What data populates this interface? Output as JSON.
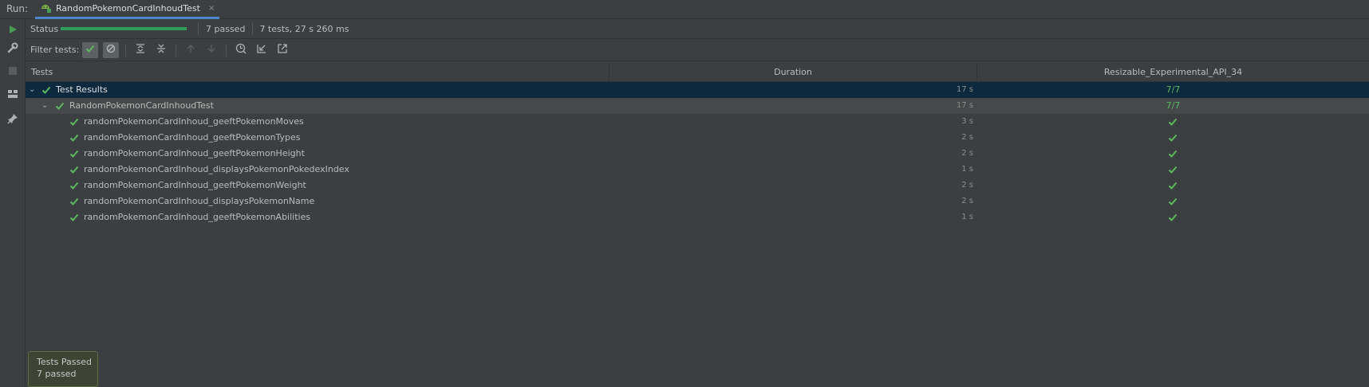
{
  "run_label": "Run:",
  "tab": {
    "title": "RandomPokemonCardInhoudTest",
    "close": "×"
  },
  "status": {
    "label": "Status",
    "progress": 1.0,
    "passed_text": "7 passed",
    "summary": "7 tests, 27 s 260 ms"
  },
  "filter": {
    "label": "Filter tests:"
  },
  "columns": {
    "tests": "Tests",
    "duration": "Duration",
    "device": "Resizable_Experimental_API_34"
  },
  "root": {
    "name": "Test Results",
    "duration": "17 s",
    "result": "7/7",
    "chevron": "⌄"
  },
  "suite": {
    "name": "RandomPokemonCardInhoudTest",
    "duration": "17 s",
    "result": "7/7",
    "chevron": "⌄"
  },
  "tests": [
    {
      "name": "randomPokemonCardInhoud_geeftPokemonMoves",
      "duration": "3 s"
    },
    {
      "name": "randomPokemonCardInhoud_geeftPokemonTypes",
      "duration": "2 s"
    },
    {
      "name": "randomPokemonCardInhoud_geeftPokemonHeight",
      "duration": "2 s"
    },
    {
      "name": "randomPokemonCardInhoud_displaysPokemonPokedexIndex",
      "duration": "1 s"
    },
    {
      "name": "randomPokemonCardInhoud_geeftPokemonWeight",
      "duration": "2 s"
    },
    {
      "name": "randomPokemonCardInhoud_displaysPokemonName",
      "duration": "2 s"
    },
    {
      "name": "randomPokemonCardInhoud_geeftPokemonAbilities",
      "duration": "1 s"
    }
  ],
  "toast": {
    "title": "Tests Passed",
    "body": "7 passed"
  },
  "colors": {
    "accent": "#4a88c7",
    "pass": "#499c54",
    "progress": "#2f9e5b",
    "selection": "#0d293e"
  }
}
